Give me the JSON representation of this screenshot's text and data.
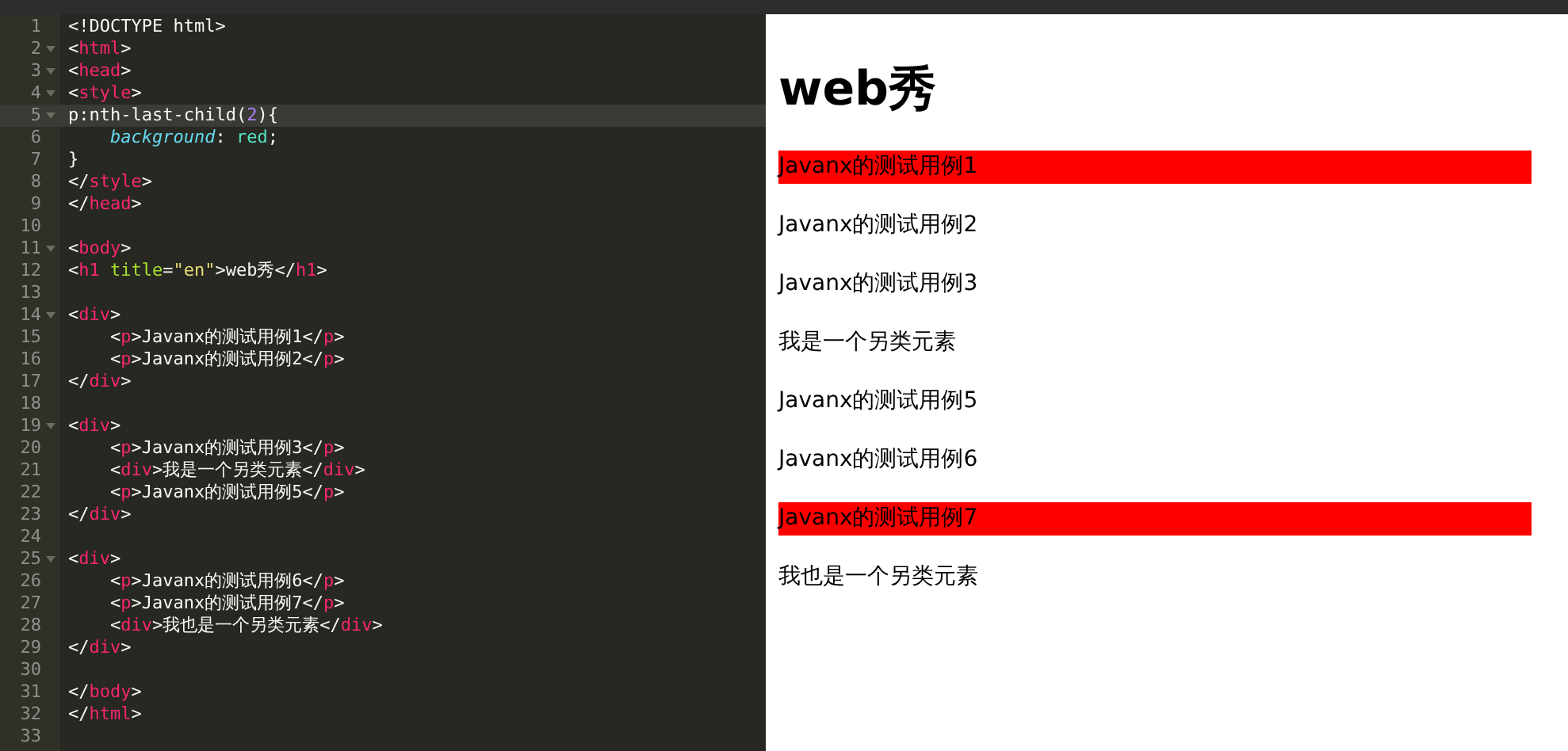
{
  "editor": {
    "lines": [
      {
        "num": "1",
        "fold": false,
        "current": false,
        "tokens": [
          {
            "kind": "plain",
            "text": "<!DOCTYPE html>"
          }
        ]
      },
      {
        "num": "2",
        "fold": true,
        "current": false,
        "tokens": [
          {
            "kind": "plain",
            "text": "<"
          },
          {
            "kind": "tag",
            "text": "html"
          },
          {
            "kind": "plain",
            "text": ">"
          }
        ]
      },
      {
        "num": "3",
        "fold": true,
        "current": false,
        "tokens": [
          {
            "kind": "plain",
            "text": "<"
          },
          {
            "kind": "tag",
            "text": "head"
          },
          {
            "kind": "plain",
            "text": ">"
          }
        ]
      },
      {
        "num": "4",
        "fold": true,
        "current": false,
        "tokens": [
          {
            "kind": "plain",
            "text": "<"
          },
          {
            "kind": "tag",
            "text": "style"
          },
          {
            "kind": "plain",
            "text": ">"
          }
        ]
      },
      {
        "num": "5",
        "fold": true,
        "current": true,
        "tokens": [
          {
            "kind": "plain",
            "text": "p:nth-last-child("
          },
          {
            "kind": "num",
            "text": "2"
          },
          {
            "kind": "plain",
            "text": "){"
          }
        ]
      },
      {
        "num": "6",
        "fold": false,
        "current": false,
        "tokens": [
          {
            "kind": "prop",
            "text": "    background"
          },
          {
            "kind": "plain",
            "text": ": "
          },
          {
            "kind": "value",
            "text": "red"
          },
          {
            "kind": "plain",
            "text": ";"
          }
        ]
      },
      {
        "num": "7",
        "fold": false,
        "current": false,
        "tokens": [
          {
            "kind": "plain",
            "text": "}"
          }
        ]
      },
      {
        "num": "8",
        "fold": false,
        "current": false,
        "tokens": [
          {
            "kind": "plain",
            "text": "</"
          },
          {
            "kind": "tag",
            "text": "style"
          },
          {
            "kind": "plain",
            "text": ">"
          }
        ]
      },
      {
        "num": "9",
        "fold": false,
        "current": false,
        "tokens": [
          {
            "kind": "plain",
            "text": "</"
          },
          {
            "kind": "tag",
            "text": "head"
          },
          {
            "kind": "plain",
            "text": ">"
          }
        ]
      },
      {
        "num": "10",
        "fold": false,
        "current": false
      },
      {
        "num": "11",
        "fold": true,
        "current": false,
        "tokens": [
          {
            "kind": "plain",
            "text": "<"
          },
          {
            "kind": "tag",
            "text": "body"
          },
          {
            "kind": "plain",
            "text": ">"
          }
        ]
      },
      {
        "num": "12",
        "fold": false,
        "current": false,
        "tokens": [
          {
            "kind": "plain",
            "text": "<"
          },
          {
            "kind": "tag",
            "text": "h1"
          },
          {
            "kind": "attr",
            "text": " title"
          },
          {
            "kind": "plain",
            "text": "="
          },
          {
            "kind": "str",
            "text": "\"en\""
          },
          {
            "kind": "plain",
            "text": ">web秀</"
          },
          {
            "kind": "tag",
            "text": "h1"
          },
          {
            "kind": "plain",
            "text": ">"
          }
        ]
      },
      {
        "num": "13",
        "fold": false,
        "current": false
      },
      {
        "num": "14",
        "fold": true,
        "current": false,
        "tokens": [
          {
            "kind": "plain",
            "text": "<"
          },
          {
            "kind": "tag",
            "text": "div"
          },
          {
            "kind": "plain",
            "text": ">"
          }
        ]
      },
      {
        "num": "15",
        "fold": false,
        "current": false,
        "tokens": [
          {
            "kind": "plain",
            "text": "    <"
          },
          {
            "kind": "tag",
            "text": "p"
          },
          {
            "kind": "plain",
            "text": ">Javanx的测试用例1</"
          },
          {
            "kind": "tag",
            "text": "p"
          },
          {
            "kind": "plain",
            "text": ">"
          }
        ]
      },
      {
        "num": "16",
        "fold": false,
        "current": false,
        "tokens": [
          {
            "kind": "plain",
            "text": "    <"
          },
          {
            "kind": "tag",
            "text": "p"
          },
          {
            "kind": "plain",
            "text": ">Javanx的测试用例2</"
          },
          {
            "kind": "tag",
            "text": "p"
          },
          {
            "kind": "plain",
            "text": ">"
          }
        ]
      },
      {
        "num": "17",
        "fold": false,
        "current": false,
        "tokens": [
          {
            "kind": "plain",
            "text": "</"
          },
          {
            "kind": "tag",
            "text": "div"
          },
          {
            "kind": "plain",
            "text": ">"
          }
        ]
      },
      {
        "num": "18",
        "fold": false,
        "current": false
      },
      {
        "num": "19",
        "fold": true,
        "current": false,
        "tokens": [
          {
            "kind": "plain",
            "text": "<"
          },
          {
            "kind": "tag",
            "text": "div"
          },
          {
            "kind": "plain",
            "text": ">"
          }
        ]
      },
      {
        "num": "20",
        "fold": false,
        "current": false,
        "tokens": [
          {
            "kind": "plain",
            "text": "    <"
          },
          {
            "kind": "tag",
            "text": "p"
          },
          {
            "kind": "plain",
            "text": ">Javanx的测试用例3</"
          },
          {
            "kind": "tag",
            "text": "p"
          },
          {
            "kind": "plain",
            "text": ">"
          }
        ]
      },
      {
        "num": "21",
        "fold": false,
        "current": false,
        "tokens": [
          {
            "kind": "plain",
            "text": "    <"
          },
          {
            "kind": "tag",
            "text": "div"
          },
          {
            "kind": "plain",
            "text": ">我是一个另类元素</"
          },
          {
            "kind": "tag",
            "text": "div"
          },
          {
            "kind": "plain",
            "text": ">"
          }
        ]
      },
      {
        "num": "22",
        "fold": false,
        "current": false,
        "tokens": [
          {
            "kind": "plain",
            "text": "    <"
          },
          {
            "kind": "tag",
            "text": "p"
          },
          {
            "kind": "plain",
            "text": ">Javanx的测试用例5</"
          },
          {
            "kind": "tag",
            "text": "p"
          },
          {
            "kind": "plain",
            "text": ">"
          }
        ]
      },
      {
        "num": "23",
        "fold": false,
        "current": false,
        "tokens": [
          {
            "kind": "plain",
            "text": "</"
          },
          {
            "kind": "tag",
            "text": "div"
          },
          {
            "kind": "plain",
            "text": ">"
          }
        ]
      },
      {
        "num": "24",
        "fold": false,
        "current": false
      },
      {
        "num": "25",
        "fold": true,
        "current": false,
        "tokens": [
          {
            "kind": "plain",
            "text": "<"
          },
          {
            "kind": "tag",
            "text": "div"
          },
          {
            "kind": "plain",
            "text": ">"
          }
        ]
      },
      {
        "num": "26",
        "fold": false,
        "current": false,
        "tokens": [
          {
            "kind": "plain",
            "text": "    <"
          },
          {
            "kind": "tag",
            "text": "p"
          },
          {
            "kind": "plain",
            "text": ">Javanx的测试用例6</"
          },
          {
            "kind": "tag",
            "text": "p"
          },
          {
            "kind": "plain",
            "text": ">"
          }
        ]
      },
      {
        "num": "27",
        "fold": false,
        "current": false,
        "tokens": [
          {
            "kind": "plain",
            "text": "    <"
          },
          {
            "kind": "tag",
            "text": "p"
          },
          {
            "kind": "plain",
            "text": ">Javanx的测试用例7</"
          },
          {
            "kind": "tag",
            "text": "p"
          },
          {
            "kind": "plain",
            "text": ">"
          }
        ]
      },
      {
        "num": "28",
        "fold": false,
        "current": false,
        "tokens": [
          {
            "kind": "plain",
            "text": "    <"
          },
          {
            "kind": "tag",
            "text": "div"
          },
          {
            "kind": "plain",
            "text": ">我也是一个另类元素</"
          },
          {
            "kind": "tag",
            "text": "div"
          },
          {
            "kind": "plain",
            "text": ">"
          }
        ]
      },
      {
        "num": "29",
        "fold": false,
        "current": false,
        "tokens": [
          {
            "kind": "plain",
            "text": "</"
          },
          {
            "kind": "tag",
            "text": "div"
          },
          {
            "kind": "plain",
            "text": ">"
          }
        ]
      },
      {
        "num": "30",
        "fold": false,
        "current": false
      },
      {
        "num": "31",
        "fold": false,
        "current": false,
        "tokens": [
          {
            "kind": "plain",
            "text": "</"
          },
          {
            "kind": "tag",
            "text": "body"
          },
          {
            "kind": "plain",
            "text": ">"
          }
        ]
      },
      {
        "num": "32",
        "fold": false,
        "current": false,
        "tokens": [
          {
            "kind": "plain",
            "text": "</"
          },
          {
            "kind": "tag",
            "text": "html"
          },
          {
            "kind": "plain",
            "text": ">"
          }
        ]
      },
      {
        "num": "33",
        "fold": false,
        "current": false
      }
    ]
  },
  "preview": {
    "heading": "web秀",
    "paragraphs": [
      {
        "text": "Javanx的测试用例1",
        "highlighted": true
      },
      {
        "text": "Javanx的测试用例2",
        "highlighted": false
      },
      {
        "text": "Javanx的测试用例3",
        "highlighted": false
      },
      {
        "text": "我是一个另类元素",
        "highlighted": false
      },
      {
        "text": "Javanx的测试用例5",
        "highlighted": false
      },
      {
        "text": "Javanx的测试用例6",
        "highlighted": false
      },
      {
        "text": "Javanx的测试用例7",
        "highlighted": true
      },
      {
        "text": "我也是一个另类元素",
        "highlighted": false
      }
    ]
  }
}
